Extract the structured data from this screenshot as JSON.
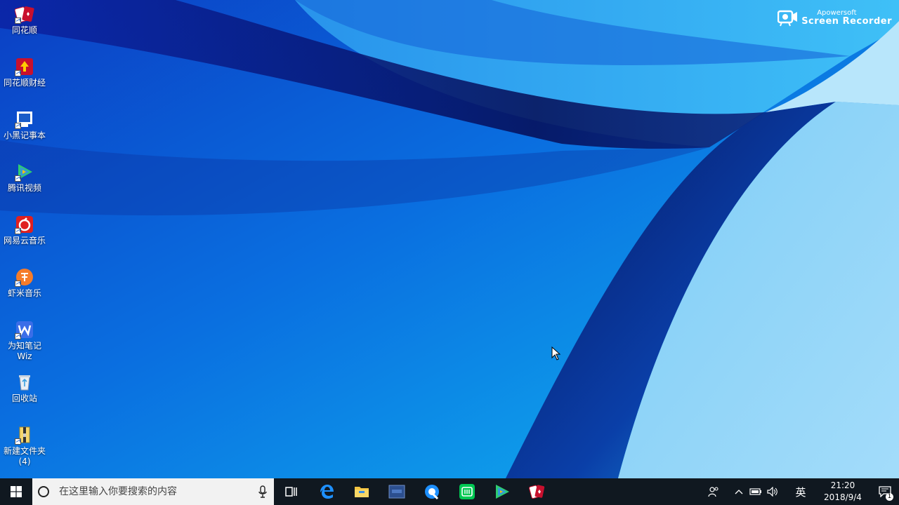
{
  "desktop": {
    "icons": [
      {
        "label": "同花顺",
        "icon": "cards-icon"
      },
      {
        "label": "同花顺财经",
        "icon": "finance-icon"
      },
      {
        "label": "小黑记事本",
        "icon": "notepad-icon"
      },
      {
        "label": "腾讯视频",
        "icon": "video-play-icon"
      },
      {
        "label": "网易云音乐",
        "icon": "netease-music-icon"
      },
      {
        "label": "虾米音乐",
        "icon": "xiami-music-icon"
      },
      {
        "label": "为知笔记\nWiz",
        "icon": "wiz-note-icon"
      },
      {
        "label": "回收站",
        "icon": "recycle-bin-icon"
      },
      {
        "label": "新建文件夹\n(4)",
        "icon": "folder-zip-icon"
      }
    ]
  },
  "watermark": {
    "brand_small": "Apowersoft",
    "brand_big": "Screen Recorder"
  },
  "taskbar": {
    "search": {
      "placeholder": "在这里输入你要搜索的内容"
    },
    "apps": [
      {
        "name": "task-view-icon"
      },
      {
        "name": "edge-icon"
      },
      {
        "name": "file-explorer-icon"
      },
      {
        "name": "screen-app-icon"
      },
      {
        "name": "recorder-icon"
      },
      {
        "name": "iqiyi-icon"
      },
      {
        "name": "tencent-video-icon"
      },
      {
        "name": "tonghuashun-icon"
      }
    ],
    "tray": {
      "ime_label": "英",
      "time": "21:20",
      "date": "2018/9/4",
      "notification_count": "1"
    }
  },
  "colors": {
    "taskbar_bg": "#101820",
    "search_bg": "#f2f2f2",
    "wallpaper_deep": "#0a2fa8",
    "wallpaper_light": "#8fd6f7"
  }
}
